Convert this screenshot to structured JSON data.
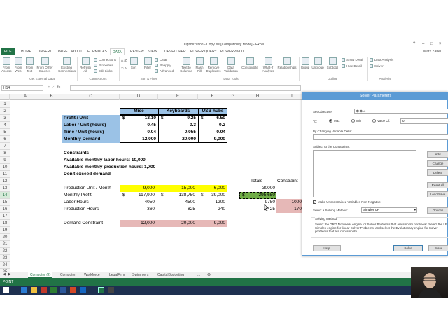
{
  "window": {
    "title": "Optimization - Copy.xls [Compatibility Mode] - Excel",
    "user": "Mark Zabel",
    "help": "?"
  },
  "ribbon_tabs": [
    "FILE",
    "HOME",
    "INSERT",
    "PAGE LAYOUT",
    "FORMULAS",
    "DATA",
    "REVIEW",
    "VIEW",
    "DEVELOPER",
    "POWER QUERY",
    "POWERPIVOT"
  ],
  "active_tab": "DATA",
  "ribbon": {
    "get_external": [
      {
        "label": "From Access"
      },
      {
        "label": "From Web"
      },
      {
        "label": "From Text"
      },
      {
        "label": "From Other Sources"
      },
      {
        "label": "Existing Connections"
      }
    ],
    "refresh": {
      "label": "Refresh All"
    },
    "connections_small": [
      "Connections",
      "Properties",
      "Edit Links"
    ],
    "sort_az": "A↓Z",
    "sort_za": "Z↓A",
    "sort": "Sort",
    "filter": "Filter",
    "filter_small": [
      "Clear",
      "Reapply",
      "Advanced"
    ],
    "data_tools": [
      {
        "label": "Text to Columns"
      },
      {
        "label": "Flash Fill"
      },
      {
        "label": "Remove Duplicates"
      },
      {
        "label": "Data Validation"
      },
      {
        "label": "Consolidate"
      },
      {
        "label": "What-If Analysis"
      },
      {
        "label": "Relationships"
      }
    ],
    "outline": [
      {
        "label": "Group"
      },
      {
        "label": "Ungroup"
      },
      {
        "label": "Subtotal"
      }
    ],
    "outline_small": [
      "Show Detail",
      "Hide Detail"
    ],
    "analysis_small": [
      "Data Analysis",
      "Solver"
    ],
    "groups": [
      "Get External Data",
      "Connections",
      "Sort & Filter",
      "Data Tools",
      "Outline",
      "Analysis"
    ]
  },
  "formula_bar": {
    "name_box": "H14",
    "fx": "fx",
    "value": ""
  },
  "columns": [
    "A",
    "B",
    "C",
    "D",
    "E",
    "F",
    "G",
    "H",
    "I"
  ],
  "rows": [
    "1",
    "2",
    "3",
    "4",
    "5",
    "6",
    "7",
    "8",
    "9",
    "10",
    "11",
    "12",
    "13",
    "14",
    "15",
    "16",
    "17",
    "18",
    "19",
    "20",
    "21",
    "22",
    "23",
    "24",
    "25"
  ],
  "cells": {
    "D2": "Mice",
    "E2": "Keyboards",
    "F2": "USB hubs",
    "C3": "Profit / Unit",
    "D3_cur": "$",
    "D3": "13.10",
    "E3_cur": "$",
    "E3": "9.25",
    "F3_cur": "$",
    "F3": "6.50",
    "C4": "Labor / Unit (hours)",
    "D4": "0.45",
    "E4": "0.3",
    "F4": "0.2",
    "C5": "Time / Unit (hours)",
    "D5": "0.04",
    "E5": "0.055",
    "F5": "0.04",
    "C6": "Monthly Demand",
    "D6": "12,000",
    "E6": "20,000",
    "F6": "9,000",
    "C8": "Constraints",
    "C9": "Available monthly labor hours: 10,000",
    "C10": "Available monthly production hours: 1,700",
    "C11": "Don't exceed demand",
    "H12": "Totals",
    "I12": "Constraint",
    "C13": "Production Unit / Month",
    "D13": "9,000",
    "E13": "15,000",
    "F13": "6,000",
    "H13": "30000",
    "C14": "Monthly Profit",
    "D14_cur": "$",
    "D14": "117,900",
    "E14_cur": "$",
    "E14": "138,750",
    "F14_cur": "$",
    "F14": "39,000",
    "H14_cur": "$",
    "H14": "295,650",
    "C15": "Labor Hours",
    "D15": "4050",
    "E15": "4500",
    "F15": "1200",
    "H15": "9750",
    "I15": "1000",
    "C16": "Production Hours",
    "D16": "360",
    "E16": "825",
    "F16": "240",
    "H16": "1425",
    "I16": "170",
    "C18": "Demand Constraint",
    "D18": "12,000",
    "E18": "20,000",
    "F18": "9,000"
  },
  "sheet_tabs": [
    "Computer (2)",
    "Computer",
    "Workforce",
    "LegalFirm",
    "Swimmers",
    "CapitalBudgeting",
    "..."
  ],
  "active_sheet": "Computer (2)",
  "status": "POINT",
  "solver": {
    "title": "Solver Parameters",
    "set_objective_label": "Set Objective:",
    "objective_value": "$H$14",
    "to_label": "To:",
    "max": "Max",
    "min": "Min",
    "value_of": "Value Of:",
    "value_of_value": "0",
    "changing_label": "By Changing Variable Cells:",
    "constraints_label": "Subject to the Constraints:",
    "buttons_right": [
      "Add",
      "Change",
      "Delete",
      "Reset All",
      "Load/Save"
    ],
    "unconstrained": "Make Unconstrained Variables Non-Negative",
    "method_label": "Select a Solving Method:",
    "method_value": "Simplex LP",
    "options": "Options",
    "solving_method_title": "Solving Method",
    "solving_method_text": "Select the GRG Nonlinear engine for Solver Problems that are smooth nonlinear. Select the LP Simplex engine for linear Solver Problems, and select the Evolutionary engine for Solver problems that are non-smooth.",
    "help": "Help",
    "solve": "Solve",
    "close": "Close"
  },
  "colors": {
    "excel_green": "#217346",
    "yellow": "#ffff00",
    "pink": "#e6b8b7",
    "blue_header": "#9bc2e6",
    "green_fill": "#70ad47",
    "dialog_blue": "#5b9bd5"
  }
}
